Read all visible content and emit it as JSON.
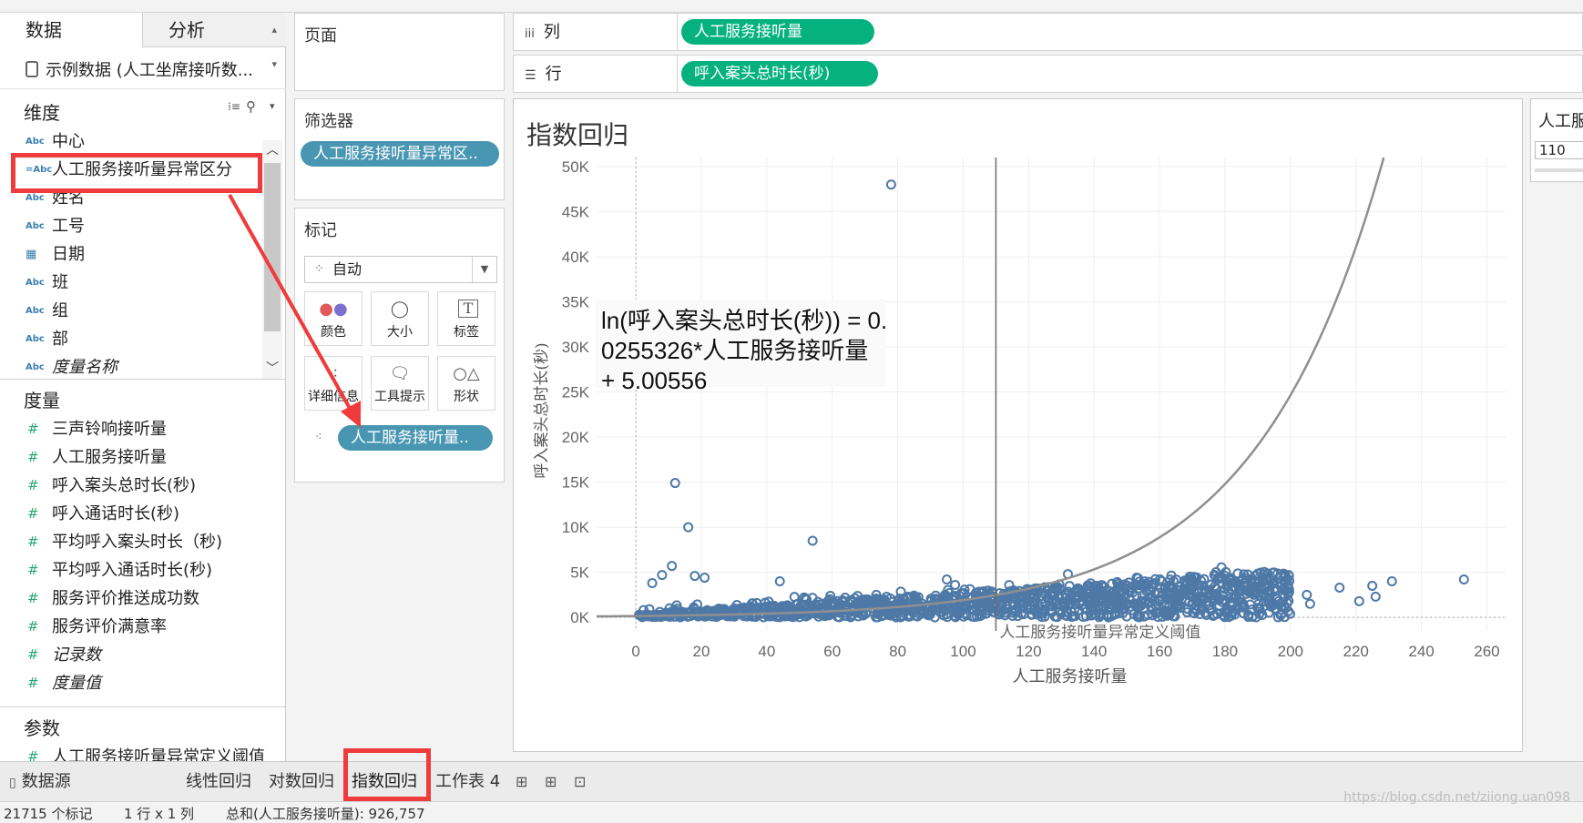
{
  "left_panel": {
    "tab_data": "数据",
    "tab_analysis": "分析",
    "datasource": "示例数据 (人工坐席接听数...",
    "dimensions_title": "维度",
    "dimensions": [
      {
        "icon": "Abc",
        "label": "中心"
      },
      {
        "icon": "=Abc",
        "label": "人工服务接听量异常区分"
      },
      {
        "icon": "Abc",
        "label": "姓名"
      },
      {
        "icon": "Abc",
        "label": "工号"
      },
      {
        "icon": "calendar",
        "label": "日期"
      },
      {
        "icon": "Abc",
        "label": "班"
      },
      {
        "icon": "Abc",
        "label": "组"
      },
      {
        "icon": "Abc",
        "label": "部"
      },
      {
        "icon": "Abc",
        "label": "度量名称"
      }
    ],
    "measures_title": "度量",
    "measures": [
      {
        "label": "三声铃响接听量",
        "italic": false
      },
      {
        "label": "人工服务接听量",
        "italic": false
      },
      {
        "label": "呼入案头总时长(秒)",
        "italic": false
      },
      {
        "label": "呼入通话时长(秒)",
        "italic": false
      },
      {
        "label": "平均呼入案头时长（秒)",
        "italic": false
      },
      {
        "label": "平均呼入通话时长(秒)",
        "italic": false
      },
      {
        "label": "服务评价推送成功数",
        "italic": false
      },
      {
        "label": "服务评价满意率",
        "italic": false
      },
      {
        "label": "记录数",
        "italic": true
      },
      {
        "label": "度量值",
        "italic": true
      }
    ],
    "parameters_title": "参数",
    "parameters": [
      {
        "label": "人工服务接听量异常定义阈值"
      }
    ]
  },
  "pages_card": {
    "title": "页面"
  },
  "filters_card": {
    "title": "筛选器",
    "pill": "人工服务接听量异常区.."
  },
  "marks_card": {
    "title": "标记",
    "mark_type": "自动",
    "buttons": [
      "颜色",
      "大小",
      "标签",
      "详细信息",
      "工具提示",
      "形状"
    ],
    "detail_pill": "人工服务接听量.."
  },
  "columns_shelf": {
    "label": "列",
    "pill": "人工服务接听量"
  },
  "rows_shelf": {
    "label": "行",
    "pill": "呼入案头总时长(秒)"
  },
  "parameter_control": {
    "title": "人工服",
    "value": "110"
  },
  "chart_data": {
    "type": "scatter",
    "title": "指数回归",
    "xlabel": "人工服务接听量",
    "ylabel": "呼入案头总时长(秒)",
    "xlim": [
      -12,
      266
    ],
    "ylim": [
      -1500,
      51000
    ],
    "xticks": [
      0,
      20,
      40,
      60,
      80,
      100,
      120,
      140,
      160,
      180,
      200,
      220,
      240,
      260
    ],
    "yticks": [
      0,
      5000,
      10000,
      15000,
      20000,
      25000,
      30000,
      35000,
      40000,
      45000,
      50000
    ],
    "ytick_labels": [
      "0K",
      "5K",
      "10K",
      "15K",
      "20K",
      "25K",
      "30K",
      "35K",
      "40K",
      "45K",
      "50K"
    ],
    "equation_lines": [
      "ln(呼入案头总时长(秒)) = 0.",
      "0255326*人工服务接听量",
      "+ 5.00556"
    ],
    "trend": {
      "a": 5.00556,
      "b": 0.0255326
    },
    "reference_line": {
      "x": 110,
      "label": "人工服务接听量异常定义阈值"
    },
    "outliers": [
      [
        78,
        48000
      ],
      [
        12,
        14900
      ],
      [
        16,
        10000
      ],
      [
        54,
        8500
      ],
      [
        11,
        5700
      ],
      [
        8,
        4700
      ],
      [
        5,
        3800
      ],
      [
        18,
        4600
      ],
      [
        21,
        4400
      ],
      [
        44,
        4000
      ],
      [
        95,
        4200
      ],
      [
        132,
        4800
      ],
      [
        153,
        4400
      ],
      [
        190,
        3800
      ],
      [
        198,
        4000
      ],
      [
        215,
        3300
      ],
      [
        225,
        3500
      ],
      [
        231,
        4000
      ],
      [
        253,
        4200
      ],
      [
        205,
        2500
      ],
      [
        221,
        1800
      ],
      [
        226,
        2300
      ],
      [
        199,
        1600
      ],
      [
        206,
        1500
      ]
    ],
    "cluster_bounds": {
      "xmin": 0,
      "xmax": 200
    }
  },
  "bottom_tabs": {
    "datasource": "数据源",
    "sheets": [
      "线性回归",
      "对数回归",
      "指数回归",
      "工作表 4"
    ],
    "active": "指数回归"
  },
  "status_bar": {
    "marks": "21715 个标记",
    "layout": "1 行 x 1 列",
    "sum": "总和(人工服务接听量): 926,757"
  },
  "watermark": "https://blog.csdn.net/ziiong.uan098",
  "colors": {
    "accent_blue": "#4996b2",
    "accent_green": "#04b17f",
    "marker": "#4e79a7",
    "highlight": "#ef3b3b"
  }
}
